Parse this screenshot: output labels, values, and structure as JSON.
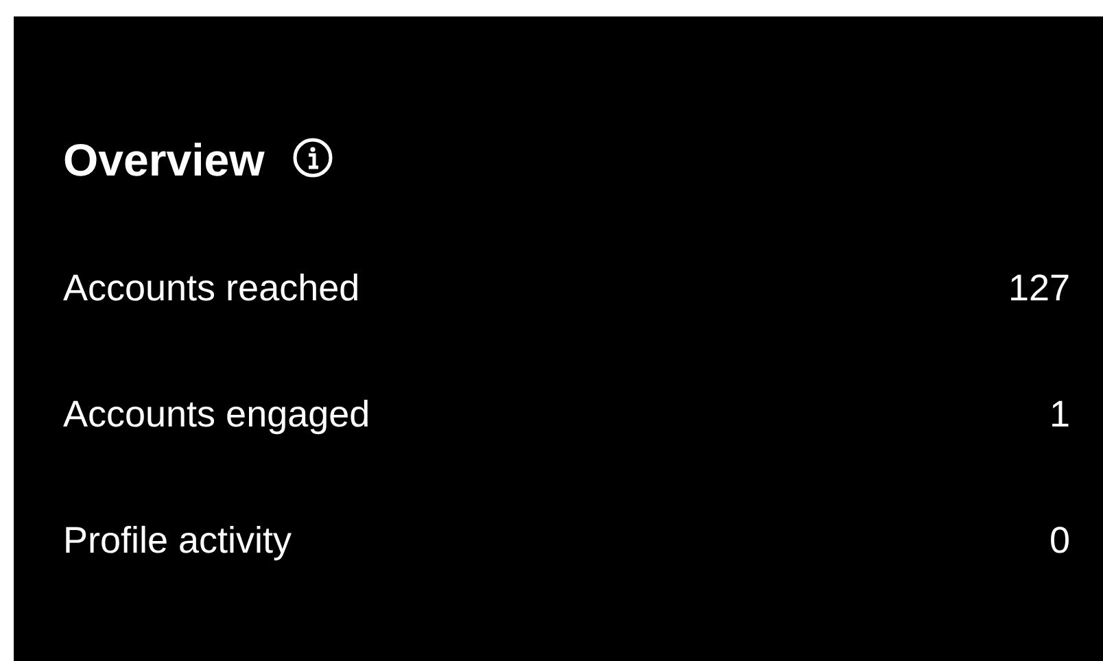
{
  "title": "Overview",
  "rows": [
    {
      "label": "Accounts reached",
      "value": "127"
    },
    {
      "label": "Accounts engaged",
      "value": "1"
    },
    {
      "label": "Profile activity",
      "value": "0"
    }
  ]
}
